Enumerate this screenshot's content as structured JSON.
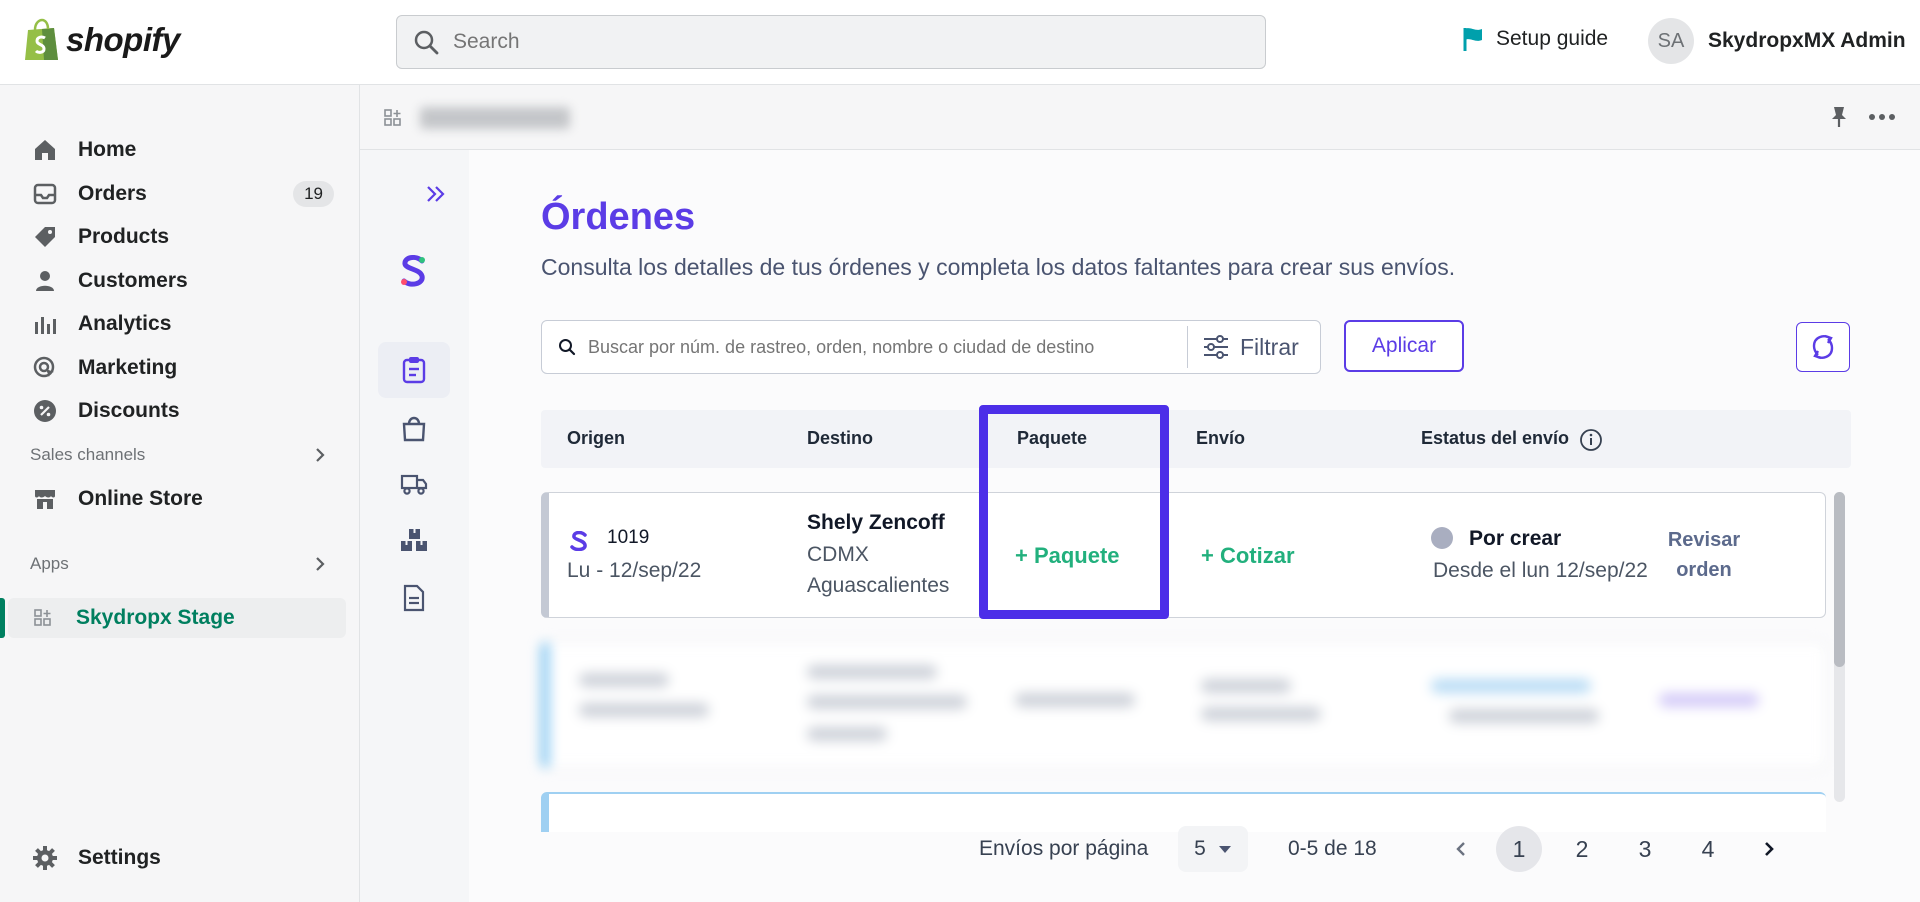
{
  "topbar": {
    "logo_text": "shopify",
    "search_placeholder": "Search",
    "setup_guide": "Setup guide",
    "avatar_initials": "SA",
    "user_name": "SkydropxMX Admin"
  },
  "sidebar": {
    "items": [
      {
        "label": "Home",
        "icon": "home-icon"
      },
      {
        "label": "Orders",
        "icon": "orders-icon",
        "badge": "19"
      },
      {
        "label": "Products",
        "icon": "tag-icon"
      },
      {
        "label": "Customers",
        "icon": "person-icon"
      },
      {
        "label": "Analytics",
        "icon": "bar-chart-icon"
      },
      {
        "label": "Marketing",
        "icon": "target-icon"
      },
      {
        "label": "Discounts",
        "icon": "discount-icon"
      }
    ],
    "sales_channels_label": "Sales channels",
    "online_store": "Online Store",
    "apps_label": "Apps",
    "active_app": "Skydropx Stage",
    "settings": "Settings"
  },
  "app": {
    "title": "Órdenes",
    "subtitle": "Consulta los detalles de tus órdenes y completa los datos faltantes para crear sus envíos.",
    "search_placeholder": "Buscar por núm. de rastreo, orden, nombre o ciudad de destino",
    "filter_label": "Filtrar",
    "apply_label": "Aplicar",
    "columns": [
      "Origen",
      "Destino",
      "Paquete",
      "Envío",
      "Estatus del envío"
    ],
    "order": {
      "number": "1019",
      "date": "Lu - 12/sep/22",
      "dest_name": "Shely Zencoff",
      "dest_city": "CDMX",
      "dest_state": "Aguascalientes",
      "package_action": "+ Paquete",
      "shipping_action": "+ Cotizar",
      "status": "Por crear",
      "status_since": "Desde el lun 12/sep/22",
      "review_line1": "Revisar",
      "review_line2": "orden"
    },
    "pagination": {
      "per_page_label": "Envíos por página",
      "per_page_value": "5",
      "range": "0-5 de 18",
      "pages": [
        "1",
        "2",
        "3",
        "4"
      ],
      "current_page": "1"
    }
  },
  "colors": {
    "brand_purple": "#5b3ce6",
    "highlight": "#4c2ee8",
    "action_green": "#22b07d",
    "shopify_green": "#008060"
  }
}
